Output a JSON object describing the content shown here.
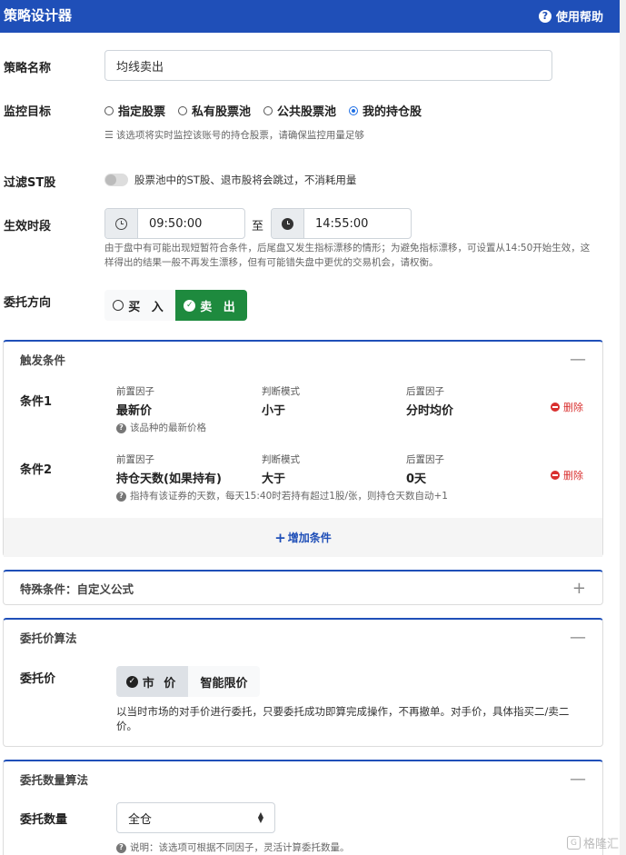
{
  "header": {
    "title": "策略设计器",
    "help_label": "使用帮助"
  },
  "form": {
    "name_label": "策略名称",
    "name_value": "均线卖出",
    "target_label": "监控目标",
    "target_options": [
      "指定股票",
      "私有股票池",
      "公共股票池",
      "我的持仓股"
    ],
    "target_selected": "我的持仓股",
    "target_hint": "该选项将实时监控该账号的持仓股票，请确保监控用量足够",
    "st_label": "过滤ST股",
    "st_hint": "股票池中的ST股、退市股将会跳过，不消耗用量",
    "time_label": "生效时段",
    "time_start": "09:50:00",
    "time_to": "至",
    "time_end": "14:55:00",
    "time_hint_1": "由于盘中有可能出现短暂符合条件，后尾盘又发生指标漂移的情形；为避免指标漂移，可设置从14:50开始生效，这",
    "time_hint_2": "样得出的结果一般不再发生漂移，但有可能错失盘中更优的交易机会，请权衡。",
    "direction_label": "委托方向",
    "direction_buy": "买 入",
    "direction_sell": "卖 出"
  },
  "trigger": {
    "title": "触发条件",
    "col_pre": "前置因子",
    "col_mode": "判断模式",
    "col_post": "后置因子",
    "delete_label": "删除",
    "conditions": [
      {
        "label": "条件1",
        "pre": "最新价",
        "mode": "小于",
        "post": "分时均价",
        "hint": "该品种的最新价格"
      },
      {
        "label": "条件2",
        "pre": "持仓天数(如果持有)",
        "mode": "大于",
        "post": "0天",
        "hint": "指持有该证券的天数，每天15:40时若持有超过1股/张，则持仓天数自动+1"
      }
    ],
    "add_label": "增加条件"
  },
  "special": {
    "title": "特殊条件：自定义公式"
  },
  "price": {
    "title": "委托价算法",
    "label": "委托价",
    "opt_market": "市 价",
    "opt_smart": "智能限价",
    "hint_1": "以当时市场的对手价进行委托，只要委托成功即算完成操作，不再撤单。对手价，具体指买二/卖二",
    "hint_2": "价。"
  },
  "quantity": {
    "title": "委托数量算法",
    "label": "委托数量",
    "value": "全仓",
    "hint": "说明：该选项可根据不同因子，灵活计算委托数量。"
  },
  "watermark": {
    "text": "格隆汇",
    "logo": "G"
  }
}
